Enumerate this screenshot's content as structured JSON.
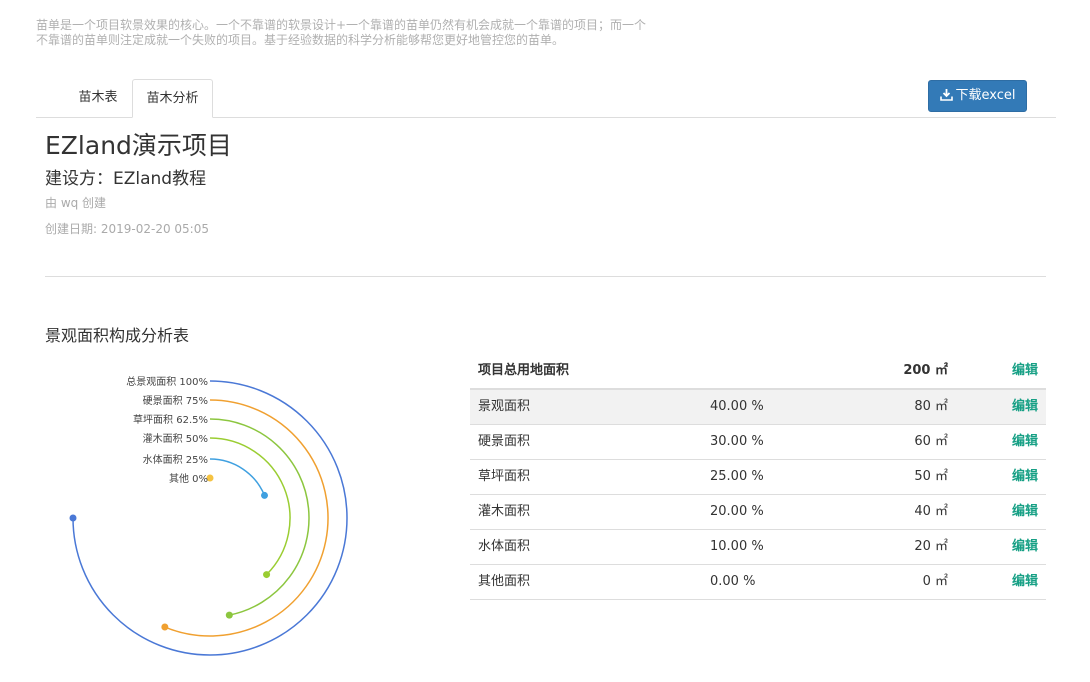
{
  "intro": "苗单是一个项目软景效果的核心。一个不靠谱的软景设计+一个靠谱的苗单仍然有机会成就一个靠谱的项目；而一个不靠谱的苗单则注定成就一个失败的项目。基于经验数据的科学分析能够帮您更好地管控您的苗单。",
  "tabs": [
    "苗木表",
    "苗木分析"
  ],
  "download_label": "下载excel",
  "project": {
    "title": "EZland演示项目",
    "builder": "建设方：EZland教程",
    "creator": "由 wq 创建",
    "created": "创建日期: 2019-02-20 05:05"
  },
  "section_title": "景观面积构成分析表",
  "chart_data": {
    "type": "polar-bar",
    "categories": [
      "总景观面积",
      "硬景面积",
      "草坪面积",
      "灌木面积",
      "水体面积",
      "其他"
    ],
    "values": [
      100,
      75,
      62.5,
      50,
      25,
      0
    ],
    "labels": [
      "总景观面积 100%",
      "硬景面积 75%",
      "草坪面积 62.5%",
      "灌木面积 50%",
      "水体面积 25%",
      "其他 0%"
    ],
    "max": 100,
    "colors": [
      "#4a78d6",
      "#f0a030",
      "#8cc63f",
      "#9acd32",
      "#3fa0e0",
      "#f5c342"
    ]
  },
  "table": {
    "header": {
      "name": "项目总用地面积",
      "area": "200 ㎡",
      "edit": "编辑"
    },
    "rows": [
      {
        "name": "景观面积",
        "pct": "40.00 %",
        "area": "80 ㎡",
        "edit": "编辑"
      },
      {
        "name": "硬景面积",
        "pct": "30.00 %",
        "area": "60 ㎡",
        "edit": "编辑"
      },
      {
        "name": "草坪面积",
        "pct": "25.00 %",
        "area": "50 ㎡",
        "edit": "编辑"
      },
      {
        "name": "灌木面积",
        "pct": "20.00 %",
        "area": "40 ㎡",
        "edit": "编辑"
      },
      {
        "name": "水体面积",
        "pct": "10.00 %",
        "area": "20 ㎡",
        "edit": "编辑"
      },
      {
        "name": "其他面积",
        "pct": "0.00 %",
        "area": "0 ㎡",
        "edit": "编辑"
      }
    ]
  }
}
